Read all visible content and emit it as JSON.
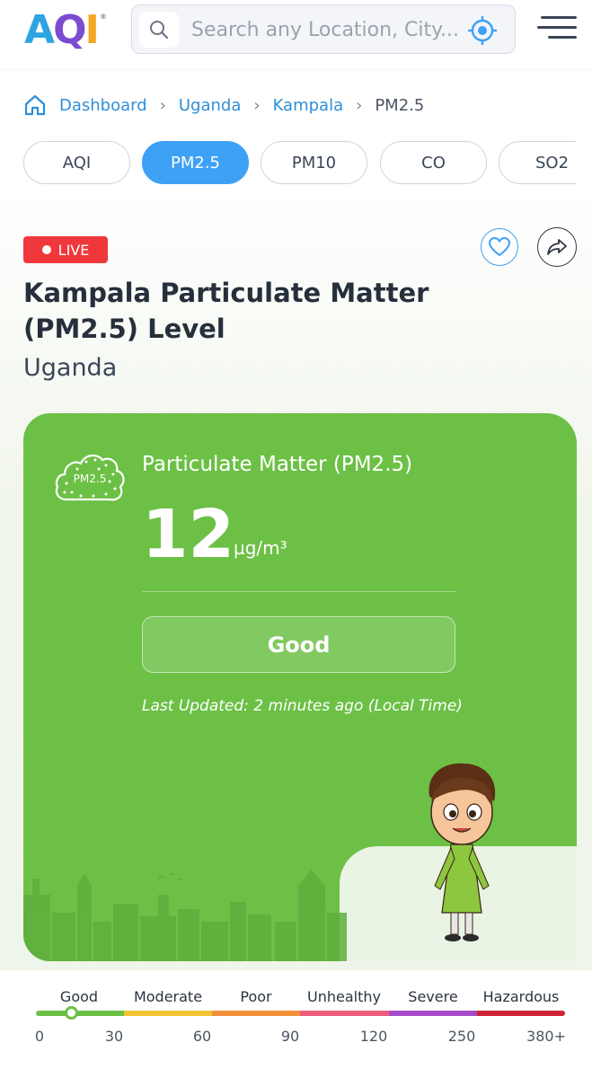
{
  "header": {
    "logo_text": "AQI",
    "logo_mark": "®",
    "search_placeholder": "Search any Location, City...",
    "icons": {
      "search": "search-icon",
      "locate": "crosshair-icon",
      "menu": "hamburger-menu-icon"
    }
  },
  "breadcrumb": {
    "items": [
      "Dashboard",
      "Uganda",
      "Kampala",
      "PM2.5"
    ]
  },
  "tabs": [
    {
      "label": "AQI",
      "active": false
    },
    {
      "label": "PM2.5",
      "active": true
    },
    {
      "label": "PM10",
      "active": false
    },
    {
      "label": "CO",
      "active": false
    },
    {
      "label": "SO2",
      "active": false
    }
  ],
  "live_badge": "LIVE",
  "page": {
    "title": "Kampala Particulate Matter (PM2.5) Level",
    "country": "Uganda"
  },
  "card": {
    "icon_label": "PM2.5",
    "pollutant_name": "Particulate Matter (PM2.5)",
    "value": "12",
    "unit": "µg/m³",
    "status": "Good",
    "updated": "Last Updated: 2 minutes ago (Local Time)",
    "color": "#6cc046"
  },
  "scale": {
    "current_value": 12,
    "categories": [
      {
        "label": "Good",
        "color": "#6cc046"
      },
      {
        "label": "Moderate",
        "color": "#f2c335"
      },
      {
        "label": "Poor",
        "color": "#f0913a"
      },
      {
        "label": "Unhealthy",
        "color": "#ec5d7b"
      },
      {
        "label": "Severe",
        "color": "#a64bc8"
      },
      {
        "label": "Hazardous",
        "color": "#cf2338"
      }
    ],
    "ticks": [
      "0",
      "30",
      "60",
      "90",
      "120",
      "250",
      "380+"
    ]
  }
}
